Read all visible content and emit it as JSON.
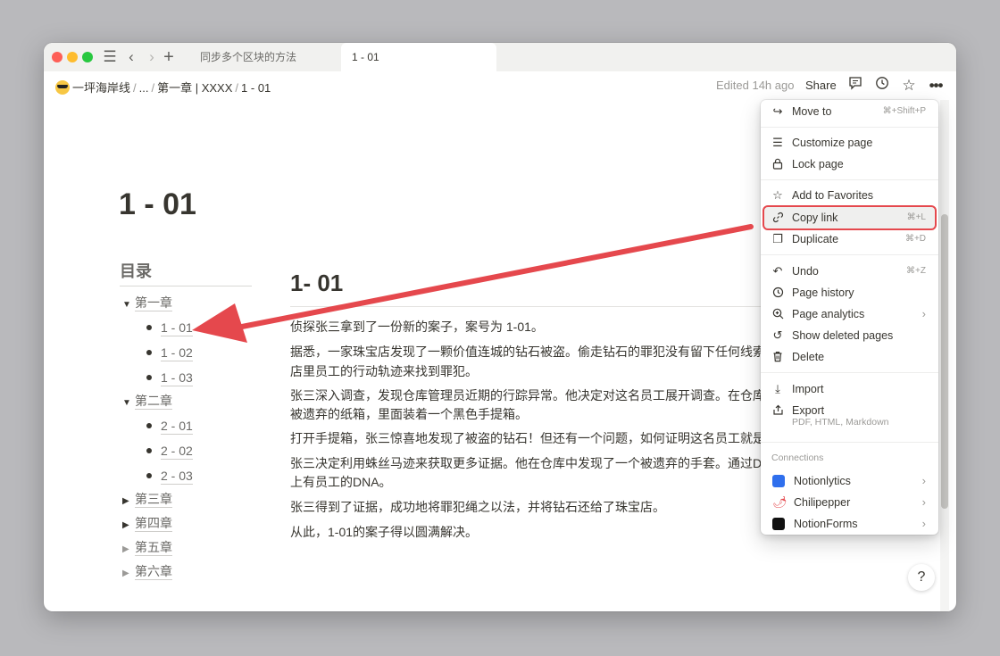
{
  "tabs": [
    {
      "label": "同步多个区块的方法"
    },
    {
      "label": "1 - 01"
    }
  ],
  "breadcrumb": {
    "workspace": "一坪海岸线",
    "ellipsis": "...",
    "chapter": "第一章 | XXXX",
    "page": "1 - 01",
    "separator": "/"
  },
  "topbar": {
    "edited": "Edited 14h ago",
    "share": "Share"
  },
  "page": {
    "title": "1 - 01",
    "toc_title": "目录",
    "toc": [
      {
        "label": "第一章",
        "level": 0,
        "expanded": true
      },
      {
        "label": "1 - 01",
        "level": 1
      },
      {
        "label": "1 - 02",
        "level": 1
      },
      {
        "label": "1 - 03",
        "level": 1
      },
      {
        "label": "第二章",
        "level": 0,
        "expanded": true
      },
      {
        "label": "2 - 01",
        "level": 1
      },
      {
        "label": "2 - 02",
        "level": 1
      },
      {
        "label": "2 - 03",
        "level": 1
      },
      {
        "label": "第三章",
        "level": 0,
        "expanded": false
      },
      {
        "label": "第四章",
        "level": 0,
        "expanded": false
      },
      {
        "label": "第五章",
        "level": 0,
        "expanded": false
      },
      {
        "label": "第六章",
        "level": 0,
        "expanded": false
      }
    ],
    "heading": "1- 01",
    "paragraphs": [
      "侦探张三拿到了一份新的案子，案号为 1-01。",
      "据悉，一家珠宝店发现了一颗价值连城的钻石被盗。偷走钻石的罪犯没有留下任何线索",
      "店里员工的行动轨迹来找到罪犯。",
      "张三深入调查，发现仓库管理员近期的行踪异常。他决定对这名员工展开调查。在仓库",
      "被遗弃的纸箱，里面装着一个黑色手提箱。",
      "打开手提箱，张三惊喜地发现了被盗的钻石！但还有一个问题，如何证明这名员工就是",
      "张三决定利用蛛丝马迹来获取更多证据。他在仓库中发现了一个被遗弃的手套。通过DN",
      "上有员工的DNA。",
      "张三得到了证据，成功地将罪犯绳之以法，并将钻石还给了珠宝店。",
      "从此，1-01的案子得以圆满解决。"
    ],
    "help": "?"
  },
  "menu": {
    "items": [
      {
        "label": "Move to",
        "shortcut": "⌘+Shift+P",
        "icon": "arrow-turn-icon"
      },
      {
        "label": "Customize page",
        "shortcut": "",
        "icon": "sliders-icon"
      },
      {
        "label": "Lock page",
        "shortcut": "",
        "icon": "lock-icon"
      },
      {
        "label": "Add to Favorites",
        "shortcut": "",
        "icon": "star-icon"
      },
      {
        "label": "Copy link",
        "shortcut": "⌘+L",
        "icon": "link-icon"
      },
      {
        "label": "Duplicate",
        "shortcut": "⌘+D",
        "icon": "duplicate-icon"
      },
      {
        "label": "Undo",
        "shortcut": "⌘+Z",
        "icon": "undo-icon"
      },
      {
        "label": "Page history",
        "shortcut": "",
        "icon": "history-icon"
      },
      {
        "label": "Page analytics",
        "shortcut": "",
        "icon": "analytics-icon"
      },
      {
        "label": "Show deleted pages",
        "shortcut": "",
        "icon": "trash-restore-icon"
      },
      {
        "label": "Delete",
        "shortcut": "",
        "icon": "trash-icon"
      },
      {
        "label": "Import",
        "shortcut": "",
        "icon": "import-icon"
      },
      {
        "label": "Export",
        "shortcut": "",
        "icon": "export-icon"
      }
    ],
    "export_sub": "PDF, HTML, Markdown",
    "connections_title": "Connections",
    "connections": [
      {
        "label": "Notionlytics",
        "color": "#2f6fed"
      },
      {
        "label": "Chilipepper",
        "color": "#e5484d"
      },
      {
        "label": "NotionForms",
        "color": "#111111"
      }
    ],
    "highlight_color": "#e5484d"
  },
  "annotation": {
    "arrow_color": "#e5484d"
  }
}
